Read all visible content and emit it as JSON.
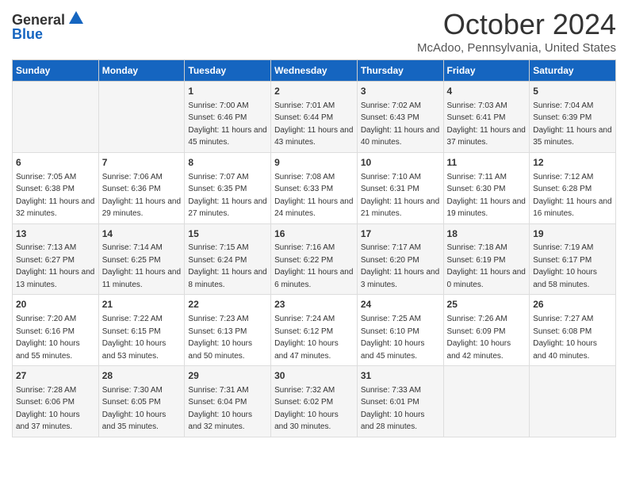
{
  "header": {
    "logo_line1": "General",
    "logo_line2": "Blue",
    "month_title": "October 2024",
    "location": "McAdoo, Pennsylvania, United States"
  },
  "days_of_week": [
    "Sunday",
    "Monday",
    "Tuesday",
    "Wednesday",
    "Thursday",
    "Friday",
    "Saturday"
  ],
  "weeks": [
    [
      {
        "day": "",
        "sunrise": "",
        "sunset": "",
        "daylight": ""
      },
      {
        "day": "",
        "sunrise": "",
        "sunset": "",
        "daylight": ""
      },
      {
        "day": "1",
        "sunrise": "Sunrise: 7:00 AM",
        "sunset": "Sunset: 6:46 PM",
        "daylight": "Daylight: 11 hours and 45 minutes."
      },
      {
        "day": "2",
        "sunrise": "Sunrise: 7:01 AM",
        "sunset": "Sunset: 6:44 PM",
        "daylight": "Daylight: 11 hours and 43 minutes."
      },
      {
        "day": "3",
        "sunrise": "Sunrise: 7:02 AM",
        "sunset": "Sunset: 6:43 PM",
        "daylight": "Daylight: 11 hours and 40 minutes."
      },
      {
        "day": "4",
        "sunrise": "Sunrise: 7:03 AM",
        "sunset": "Sunset: 6:41 PM",
        "daylight": "Daylight: 11 hours and 37 minutes."
      },
      {
        "day": "5",
        "sunrise": "Sunrise: 7:04 AM",
        "sunset": "Sunset: 6:39 PM",
        "daylight": "Daylight: 11 hours and 35 minutes."
      }
    ],
    [
      {
        "day": "6",
        "sunrise": "Sunrise: 7:05 AM",
        "sunset": "Sunset: 6:38 PM",
        "daylight": "Daylight: 11 hours and 32 minutes."
      },
      {
        "day": "7",
        "sunrise": "Sunrise: 7:06 AM",
        "sunset": "Sunset: 6:36 PM",
        "daylight": "Daylight: 11 hours and 29 minutes."
      },
      {
        "day": "8",
        "sunrise": "Sunrise: 7:07 AM",
        "sunset": "Sunset: 6:35 PM",
        "daylight": "Daylight: 11 hours and 27 minutes."
      },
      {
        "day": "9",
        "sunrise": "Sunrise: 7:08 AM",
        "sunset": "Sunset: 6:33 PM",
        "daylight": "Daylight: 11 hours and 24 minutes."
      },
      {
        "day": "10",
        "sunrise": "Sunrise: 7:10 AM",
        "sunset": "Sunset: 6:31 PM",
        "daylight": "Daylight: 11 hours and 21 minutes."
      },
      {
        "day": "11",
        "sunrise": "Sunrise: 7:11 AM",
        "sunset": "Sunset: 6:30 PM",
        "daylight": "Daylight: 11 hours and 19 minutes."
      },
      {
        "day": "12",
        "sunrise": "Sunrise: 7:12 AM",
        "sunset": "Sunset: 6:28 PM",
        "daylight": "Daylight: 11 hours and 16 minutes."
      }
    ],
    [
      {
        "day": "13",
        "sunrise": "Sunrise: 7:13 AM",
        "sunset": "Sunset: 6:27 PM",
        "daylight": "Daylight: 11 hours and 13 minutes."
      },
      {
        "day": "14",
        "sunrise": "Sunrise: 7:14 AM",
        "sunset": "Sunset: 6:25 PM",
        "daylight": "Daylight: 11 hours and 11 minutes."
      },
      {
        "day": "15",
        "sunrise": "Sunrise: 7:15 AM",
        "sunset": "Sunset: 6:24 PM",
        "daylight": "Daylight: 11 hours and 8 minutes."
      },
      {
        "day": "16",
        "sunrise": "Sunrise: 7:16 AM",
        "sunset": "Sunset: 6:22 PM",
        "daylight": "Daylight: 11 hours and 6 minutes."
      },
      {
        "day": "17",
        "sunrise": "Sunrise: 7:17 AM",
        "sunset": "Sunset: 6:20 PM",
        "daylight": "Daylight: 11 hours and 3 minutes."
      },
      {
        "day": "18",
        "sunrise": "Sunrise: 7:18 AM",
        "sunset": "Sunset: 6:19 PM",
        "daylight": "Daylight: 11 hours and 0 minutes."
      },
      {
        "day": "19",
        "sunrise": "Sunrise: 7:19 AM",
        "sunset": "Sunset: 6:17 PM",
        "daylight": "Daylight: 10 hours and 58 minutes."
      }
    ],
    [
      {
        "day": "20",
        "sunrise": "Sunrise: 7:20 AM",
        "sunset": "Sunset: 6:16 PM",
        "daylight": "Daylight: 10 hours and 55 minutes."
      },
      {
        "day": "21",
        "sunrise": "Sunrise: 7:22 AM",
        "sunset": "Sunset: 6:15 PM",
        "daylight": "Daylight: 10 hours and 53 minutes."
      },
      {
        "day": "22",
        "sunrise": "Sunrise: 7:23 AM",
        "sunset": "Sunset: 6:13 PM",
        "daylight": "Daylight: 10 hours and 50 minutes."
      },
      {
        "day": "23",
        "sunrise": "Sunrise: 7:24 AM",
        "sunset": "Sunset: 6:12 PM",
        "daylight": "Daylight: 10 hours and 47 minutes."
      },
      {
        "day": "24",
        "sunrise": "Sunrise: 7:25 AM",
        "sunset": "Sunset: 6:10 PM",
        "daylight": "Daylight: 10 hours and 45 minutes."
      },
      {
        "day": "25",
        "sunrise": "Sunrise: 7:26 AM",
        "sunset": "Sunset: 6:09 PM",
        "daylight": "Daylight: 10 hours and 42 minutes."
      },
      {
        "day": "26",
        "sunrise": "Sunrise: 7:27 AM",
        "sunset": "Sunset: 6:08 PM",
        "daylight": "Daylight: 10 hours and 40 minutes."
      }
    ],
    [
      {
        "day": "27",
        "sunrise": "Sunrise: 7:28 AM",
        "sunset": "Sunset: 6:06 PM",
        "daylight": "Daylight: 10 hours and 37 minutes."
      },
      {
        "day": "28",
        "sunrise": "Sunrise: 7:30 AM",
        "sunset": "Sunset: 6:05 PM",
        "daylight": "Daylight: 10 hours and 35 minutes."
      },
      {
        "day": "29",
        "sunrise": "Sunrise: 7:31 AM",
        "sunset": "Sunset: 6:04 PM",
        "daylight": "Daylight: 10 hours and 32 minutes."
      },
      {
        "day": "30",
        "sunrise": "Sunrise: 7:32 AM",
        "sunset": "Sunset: 6:02 PM",
        "daylight": "Daylight: 10 hours and 30 minutes."
      },
      {
        "day": "31",
        "sunrise": "Sunrise: 7:33 AM",
        "sunset": "Sunset: 6:01 PM",
        "daylight": "Daylight: 10 hours and 28 minutes."
      },
      {
        "day": "",
        "sunrise": "",
        "sunset": "",
        "daylight": ""
      },
      {
        "day": "",
        "sunrise": "",
        "sunset": "",
        "daylight": ""
      }
    ]
  ]
}
